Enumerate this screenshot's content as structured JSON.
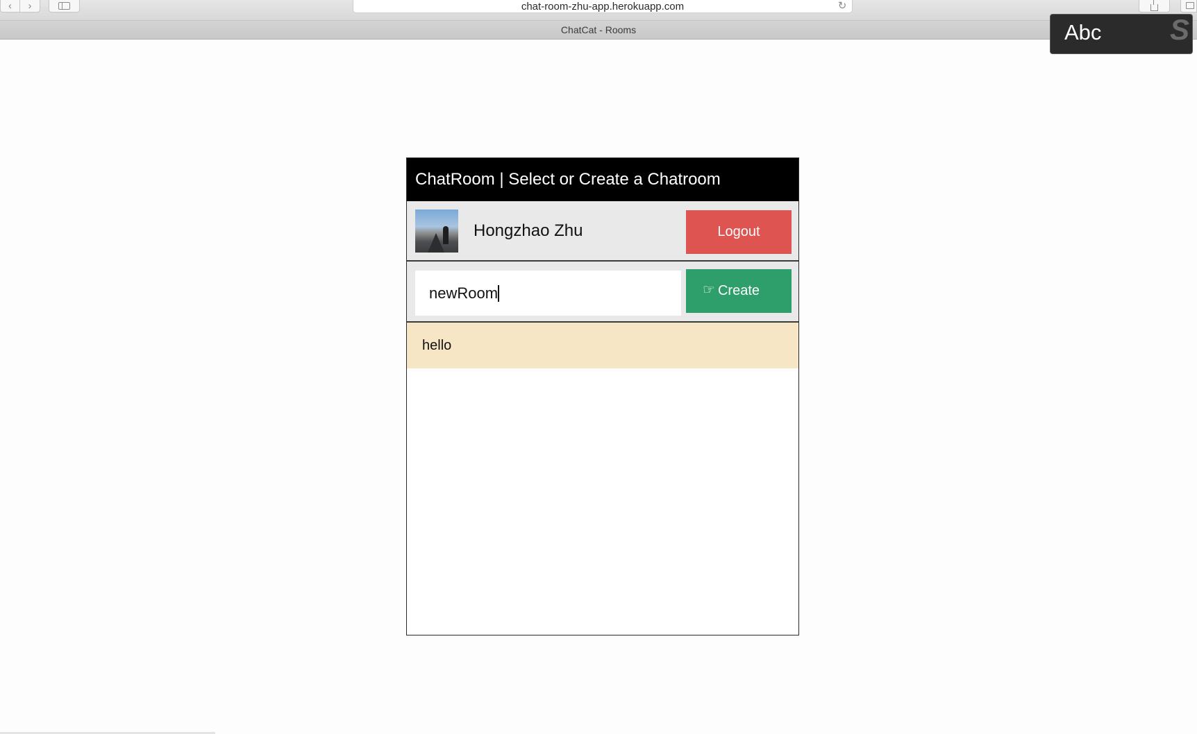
{
  "browser": {
    "url": "chat-room-zhu-app.herokuapp.com",
    "tab_title": "ChatCat - Rooms",
    "icons": {
      "back": "chevron-left-icon",
      "forward": "chevron-right-icon",
      "sidebar": "sidebar-icon",
      "reload": "reload-icon",
      "share": "share-icon",
      "tabs": "tabs-icon"
    }
  },
  "input_method": {
    "label": "Abc",
    "badge": "S"
  },
  "app": {
    "header_title": "ChatRoom | Select or Create a Chatroom",
    "user": {
      "name": "Hongzhao Zhu",
      "logout_label": "Logout"
    },
    "create": {
      "input_value": "newRoom",
      "button_label": "Create"
    },
    "rooms": [
      {
        "name": "hello"
      }
    ],
    "colors": {
      "header_bg": "#000000",
      "logout_bg": "#dd5451",
      "create_bg": "#2e9e6a",
      "room_bg": "#f6e6c5",
      "row_bg": "#e9e9e9"
    }
  }
}
